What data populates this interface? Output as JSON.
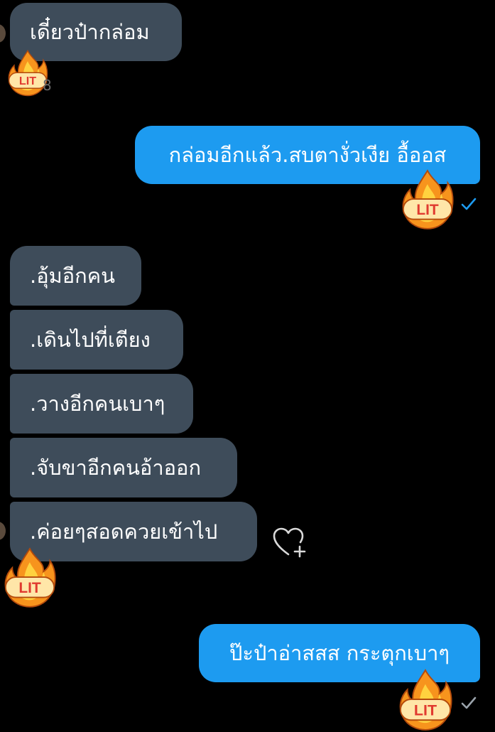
{
  "messages": [
    {
      "id": "m1",
      "direction": "incoming",
      "text": "เดี๋ยวป๋ากล่อม",
      "reaction_badge": "LIT"
    },
    {
      "id": "m2",
      "direction": "outgoing",
      "text": "กล่อมอีกแล้ว.สบตางั่วเงีย อื้ออส",
      "reaction_badge": "LIT",
      "status": "sent"
    },
    {
      "id": "m3",
      "direction": "incoming",
      "text": ".อุ้มอีกคน"
    },
    {
      "id": "m4",
      "direction": "incoming",
      "text": ".เดินไปที่เตียง"
    },
    {
      "id": "m5",
      "direction": "incoming",
      "text": ".วางอีกคนเบาๆ"
    },
    {
      "id": "m6",
      "direction": "incoming",
      "text": ".จับขาอีกคนอ้าออก"
    },
    {
      "id": "m7",
      "direction": "incoming",
      "text": ".ค่อยๆสอดควยเข้าไป",
      "reaction_badge": "LIT"
    },
    {
      "id": "m8",
      "direction": "outgoing",
      "text": "ป๊ะป๋าอ่าสสส กระตุกเบาๆ",
      "reaction_badge": "LIT",
      "status": "sent"
    }
  ],
  "reaction_count_fragment": "8",
  "colors": {
    "background": "#000000",
    "incoming_bubble": "#3e4c5a",
    "outgoing_bubble": "#1d9bf0",
    "text": "#ffffff",
    "check": "#1d9bf0",
    "flame_outer": "#f7941d",
    "flame_inner": "#ffd23f",
    "lit_text": "#e03a2f"
  },
  "icons": {
    "reaction": "lit-fire-icon",
    "sent_status": "check-icon",
    "add_reaction": "heart-plus-icon"
  }
}
